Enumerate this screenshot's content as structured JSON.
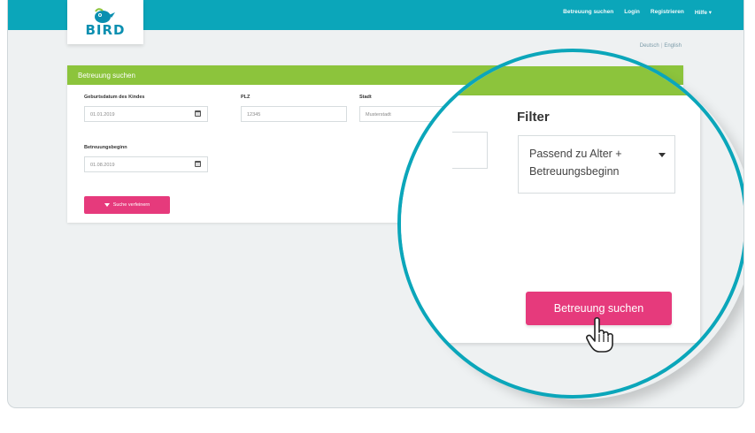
{
  "logo": {
    "word": "BIRD"
  },
  "nav": {
    "items": [
      "Betreuung suchen",
      "Login",
      "Registrieren",
      "Hilfe ▾"
    ]
  },
  "lang": {
    "de": "Deutsch",
    "en": "English"
  },
  "panel": {
    "title": "Betreuung suchen",
    "birthdate_label": "Geburtsdatum des Kindes",
    "birthdate_value": "01.01.2019",
    "plz_label": "PLZ",
    "plz_value": "12345",
    "stadt_label": "Stadt",
    "stadt_value": "Musterstadt",
    "start_label": "Betreuungsbeginn",
    "start_value": "01.08.2019",
    "toggle_label": "Suche verfeinern"
  },
  "magnifier": {
    "filter_title": "Filter",
    "filter_line1": "Passend zu Alter +",
    "filter_line2": "Betreuungsbeginn",
    "search_button": "Betreuung suchen"
  },
  "colors": {
    "topbar": "#0ba6ba",
    "panel_header": "#8cc43c",
    "accent_button": "#e63a7c"
  }
}
